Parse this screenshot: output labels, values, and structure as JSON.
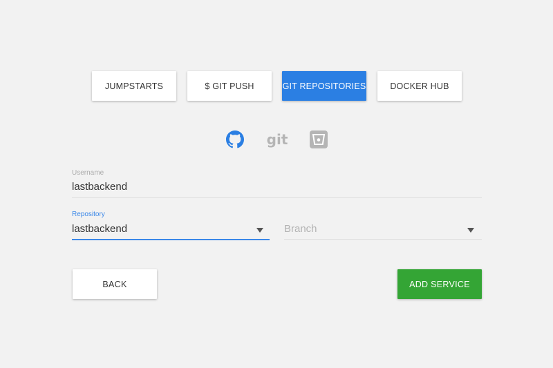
{
  "tabs": [
    {
      "label": "JUMPSTARTS",
      "active": false
    },
    {
      "label": "$ GIT PUSH",
      "active": false
    },
    {
      "label": "GIT REPOSITORIES",
      "active": true
    },
    {
      "label": "DOCKER HUB",
      "active": false
    }
  ],
  "providers": [
    {
      "name": "github-icon",
      "active": true,
      "color": "#2b7fe3"
    },
    {
      "name": "git-icon",
      "text": "git",
      "active": false,
      "color": "#b5b5b5"
    },
    {
      "name": "bitbucket-icon",
      "active": false,
      "color": "#b5b5b5"
    }
  ],
  "form": {
    "username": {
      "label": "Username",
      "value": "lastbackend"
    },
    "repository": {
      "label": "Repository",
      "value": "lastbackend"
    },
    "branch": {
      "placeholder": "Branch",
      "value": ""
    }
  },
  "actions": {
    "back_label": "BACK",
    "add_label": "ADD SERVICE"
  },
  "colors": {
    "accent": "#2b7fe3",
    "success": "#34a535",
    "background": "#f2f2f2"
  }
}
